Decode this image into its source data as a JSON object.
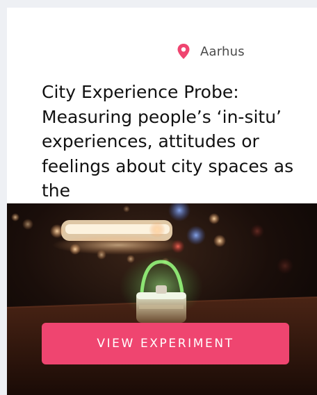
{
  "card": {
    "location": {
      "icon": "map-pin-icon",
      "label": "Aarhus",
      "icon_color": "#ef4570"
    },
    "title": "City Experience Probe: Measuring people’s ‘in-situ’ experiences, attitudes or feelings about city spaces as the",
    "image": {
      "subject": "glowing-lantern-night-photo"
    },
    "cta": {
      "label": "VIEW EXPERIMENT",
      "color": "#ef4570"
    }
  }
}
